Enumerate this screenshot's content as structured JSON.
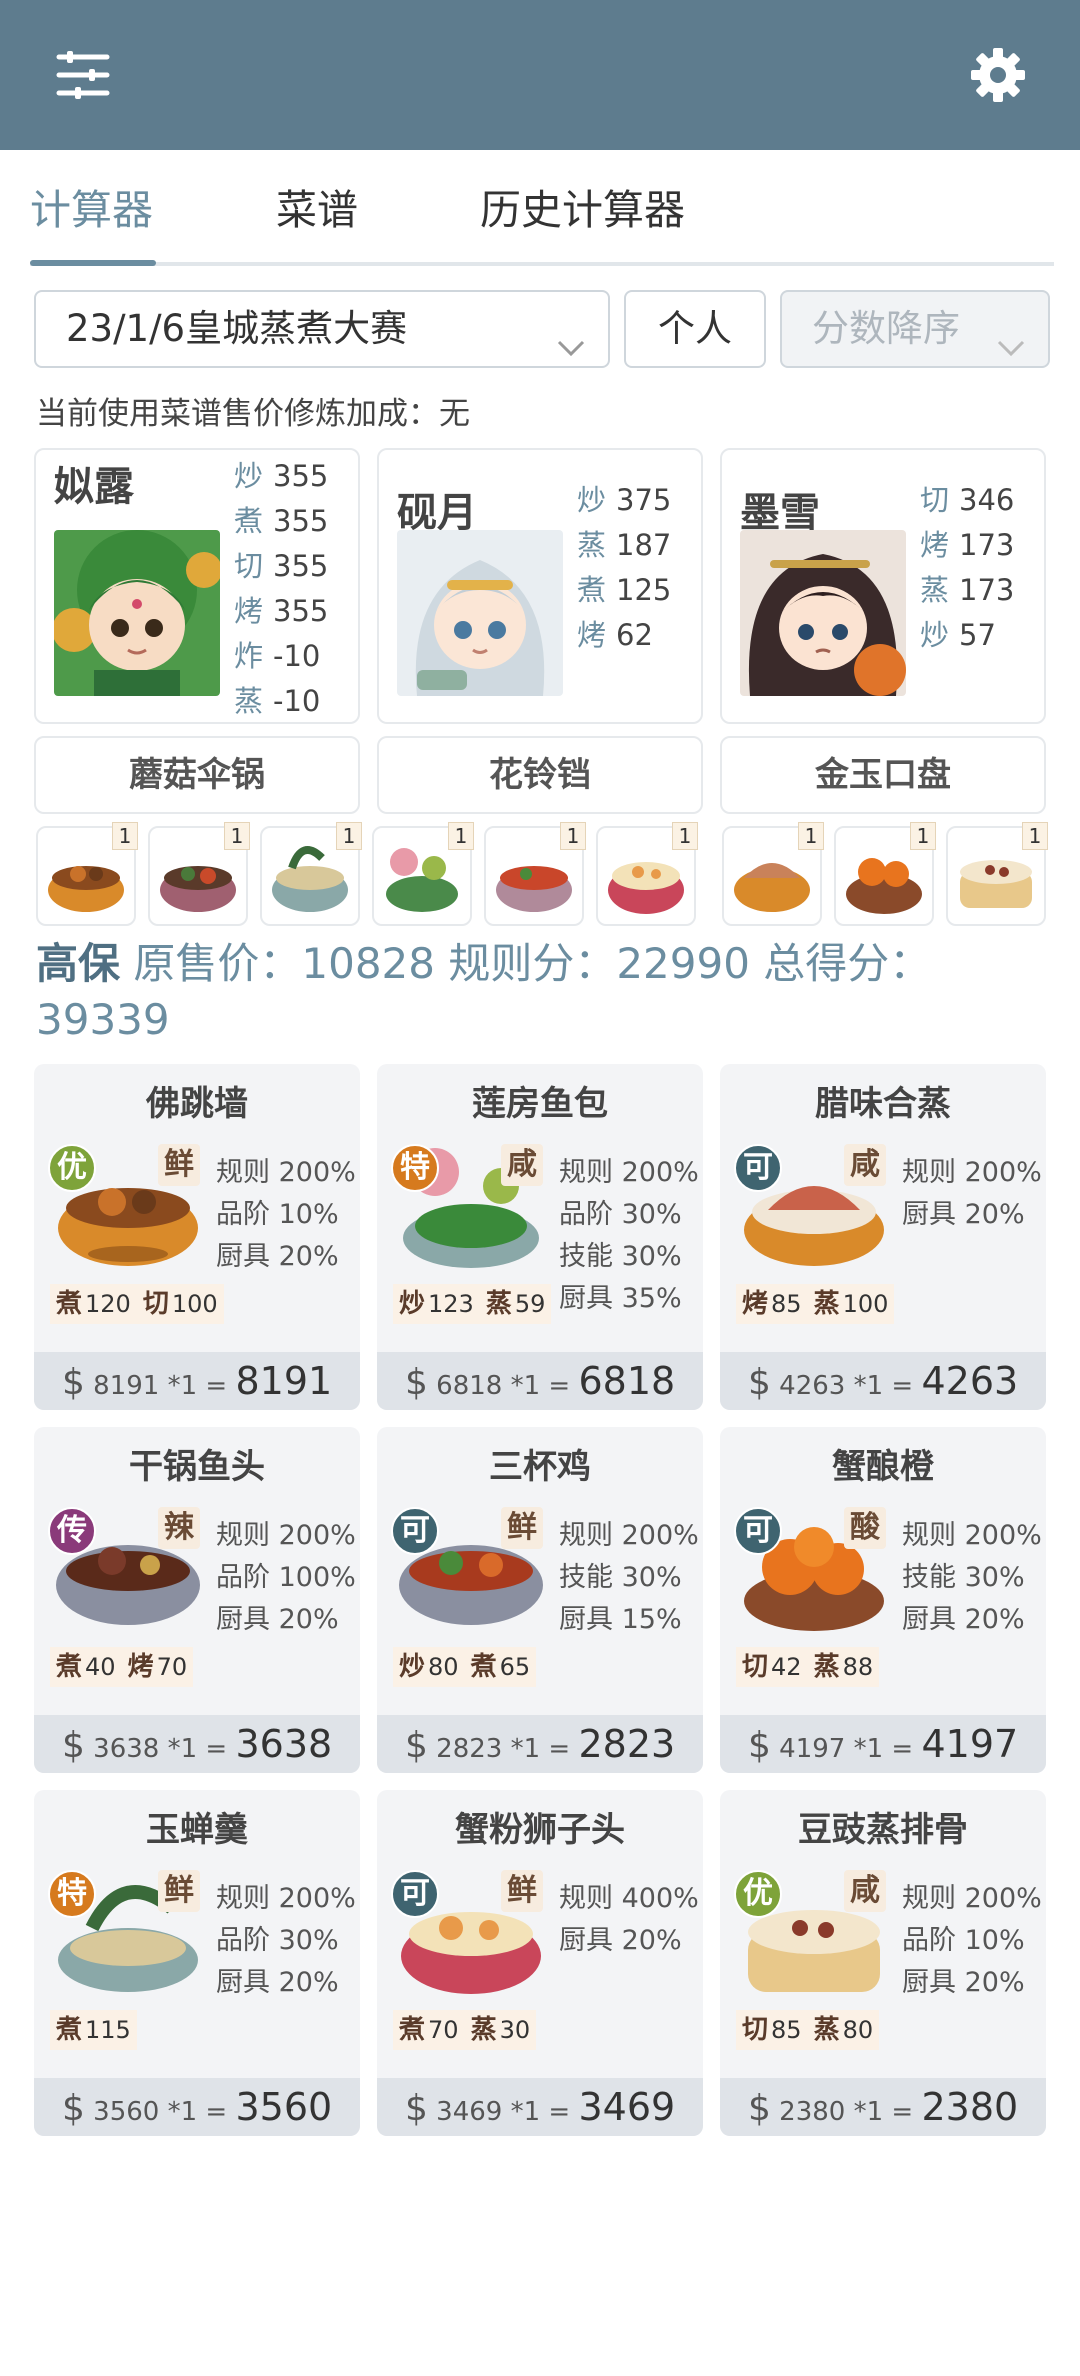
{
  "header": {
    "left_icon": "sliders-icon",
    "right_icon": "gear-icon"
  },
  "tabs": [
    {
      "label": "计算器",
      "active": true
    },
    {
      "label": "菜谱",
      "active": false
    },
    {
      "label": "历史计算器",
      "active": false
    }
  ],
  "controls": {
    "contest_value": "23/1/6皇城蒸煮大赛",
    "mode_label": "个人",
    "sort_value": "分数降序"
  },
  "bonus_text": "当前使用菜谱售价修炼加成：无",
  "chefs": [
    {
      "name": "姒露",
      "skills": [
        {
          "k": "炒",
          "v": "355"
        },
        {
          "k": "煮",
          "v": "355"
        },
        {
          "k": "切",
          "v": "355"
        },
        {
          "k": "烤",
          "v": "355"
        },
        {
          "k": "炸",
          "v": "-10"
        },
        {
          "k": "蒸",
          "v": "-10"
        }
      ]
    },
    {
      "name": "砚月",
      "skills": [
        {
          "k": "炒",
          "v": "375"
        },
        {
          "k": "蒸",
          "v": "187"
        },
        {
          "k": "煮",
          "v": "125"
        },
        {
          "k": "烤",
          "v": "62"
        }
      ]
    },
    {
      "name": "墨雪",
      "skills": [
        {
          "k": "切",
          "v": "346"
        },
        {
          "k": "烤",
          "v": "173"
        },
        {
          "k": "蒸",
          "v": "173"
        },
        {
          "k": "炒",
          "v": "57"
        }
      ]
    }
  ],
  "equipment": [
    "蘑菇伞锅",
    "花铃铛",
    "金玉口盘"
  ],
  "dish_thumbs": [
    "1",
    "1",
    "1",
    "1",
    "1",
    "1",
    "1",
    "1",
    "1"
  ],
  "summary": {
    "label": "高保",
    "text": "原售价：10828 规则分：22990 总得分：39339"
  },
  "recipes": [
    {
      "name": "佛跳墙",
      "grade": "优",
      "flavor": "鲜",
      "mods": [
        "规则 200%",
        "品阶 10%",
        "厨具 20%"
      ],
      "skills": [
        {
          "k": "煮",
          "v": "120"
        },
        {
          "k": "切",
          "v": "100"
        }
      ],
      "price": "8191",
      "mult": "*1 =",
      "total": "8191"
    },
    {
      "name": "莲房鱼包",
      "grade": "特",
      "flavor": "咸",
      "mods": [
        "规则 200%",
        "品阶 30%",
        "技能 30%",
        "厨具 35%"
      ],
      "skills": [
        {
          "k": "炒",
          "v": "123"
        },
        {
          "k": "蒸",
          "v": "59"
        }
      ],
      "price": "6818",
      "mult": "*1 =",
      "total": "6818"
    },
    {
      "name": "腊味合蒸",
      "grade": "可",
      "flavor": "咸",
      "mods": [
        "规则 200%",
        "厨具 20%"
      ],
      "skills": [
        {
          "k": "烤",
          "v": "85"
        },
        {
          "k": "蒸",
          "v": "100"
        }
      ],
      "price": "4263",
      "mult": "*1 =",
      "total": "4263"
    },
    {
      "name": "干锅鱼头",
      "grade": "传",
      "flavor": "辣",
      "mods": [
        "规则 200%",
        "品阶 100%",
        "厨具 20%"
      ],
      "skills": [
        {
          "k": "煮",
          "v": "40"
        },
        {
          "k": "烤",
          "v": "70"
        }
      ],
      "price": "3638",
      "mult": "*1 =",
      "total": "3638"
    },
    {
      "name": "三杯鸡",
      "grade": "可",
      "flavor": "鲜",
      "mods": [
        "规则 200%",
        "技能 30%",
        "厨具 15%"
      ],
      "skills": [
        {
          "k": "炒",
          "v": "80"
        },
        {
          "k": "煮",
          "v": "65"
        }
      ],
      "price": "2823",
      "mult": "*1 =",
      "total": "2823"
    },
    {
      "name": "蟹酿橙",
      "grade": "可",
      "flavor": "酸",
      "mods": [
        "规则 200%",
        "技能 30%",
        "厨具 20%"
      ],
      "skills": [
        {
          "k": "切",
          "v": "42"
        },
        {
          "k": "蒸",
          "v": "88"
        }
      ],
      "price": "4197",
      "mult": "*1 =",
      "total": "4197"
    },
    {
      "name": "玉蝉羹",
      "grade": "特",
      "flavor": "鲜",
      "mods": [
        "规则 200%",
        "品阶 30%",
        "厨具 20%"
      ],
      "skills": [
        {
          "k": "煮",
          "v": "115"
        }
      ],
      "price": "3560",
      "mult": "*1 =",
      "total": "3560"
    },
    {
      "name": "蟹粉狮子头",
      "grade": "可",
      "flavor": "鲜",
      "mods": [
        "规则 400%",
        "厨具 20%"
      ],
      "skills": [
        {
          "k": "煮",
          "v": "70"
        },
        {
          "k": "蒸",
          "v": "30"
        }
      ],
      "price": "3469",
      "mult": "*1 =",
      "total": "3469"
    },
    {
      "name": "豆豉蒸排骨",
      "grade": "优",
      "flavor": "咸",
      "mods": [
        "规则 200%",
        "品阶 10%",
        "厨具 20%"
      ],
      "skills": [
        {
          "k": "切",
          "v": "85"
        },
        {
          "k": "蒸",
          "v": "80"
        }
      ],
      "price": "2380",
      "mult": "*1 =",
      "total": "2380"
    }
  ],
  "colors": {
    "header": "#5e7c8e",
    "accent": "#6b8da0",
    "grade_you": "#7ea33a",
    "grade_te": "#d67a1e",
    "grade_ke": "#3f6470",
    "grade_chuan": "#8a3a7a"
  }
}
